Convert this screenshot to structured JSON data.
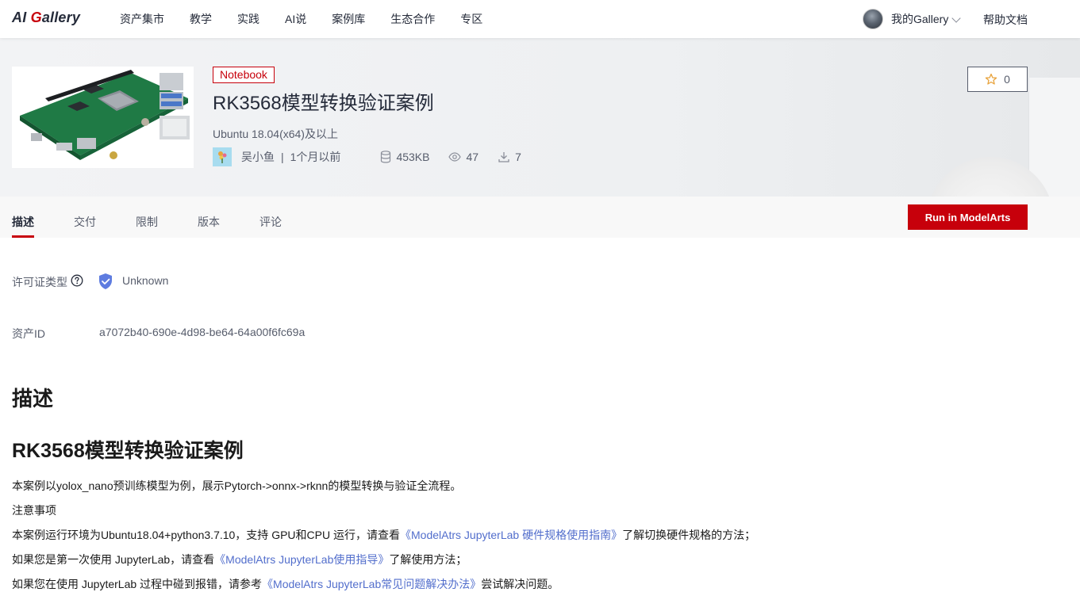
{
  "nav": {
    "logo_prefix": "AI ",
    "logo_accent": "G",
    "logo_suffix": "allery",
    "items": [
      "资产集市",
      "教学",
      "实践",
      "AI说",
      "案例库",
      "生态合作",
      "专区"
    ],
    "user_label": "我的Gallery",
    "help_label": "帮助文档"
  },
  "asset": {
    "badge": "Notebook",
    "title": "RK3568模型转换验证案例",
    "env": "Ubuntu 18.04(x64)及以上",
    "author": "吴小鱼",
    "separator": "|",
    "time": "1个月以前",
    "size": "453KB",
    "views": "47",
    "downloads": "7",
    "stars": "0"
  },
  "tabs": [
    "描述",
    "交付",
    "限制",
    "版本",
    "评论"
  ],
  "run_button": "Run in ModelArts",
  "info": {
    "license_label": "许可证类型",
    "license_value": "Unknown",
    "asset_id_label": "资产ID",
    "asset_id_value": "a7072b40-690e-4d98-be64-64a00f6fc69a"
  },
  "content": {
    "h1": "描述",
    "h2": "RK3568模型转换验证案例",
    "p1": "本案例以yolox_nano预训练模型为例，展示Pytorch->onnx->rknn的模型转换与验证全流程。",
    "p2": "注意事项",
    "p3_pre": "本案例运行环境为Ubuntu18.04+python3.7.10，支持 GPU和CPU 运行，请查看",
    "p3_link": "《ModelAtrs JupyterLab 硬件规格使用指南》",
    "p3_post": "了解切换硬件规格的方法；",
    "p4_pre": "如果您是第一次使用 JupyterLab，请查看",
    "p4_link": "《ModelAtrs JupyterLab使用指导》",
    "p4_post": "了解使用方法；",
    "p5_pre": "如果您在使用 JupyterLab 过程中碰到报错，请参考",
    "p5_link": "《ModelAtrs JupyterLab常见问题解决办法》",
    "p5_post": "尝试解决问题。"
  },
  "colors": {
    "accent": "#c7000b",
    "link": "#526ecc",
    "text": "#252b3a",
    "muted": "#575d6c",
    "shield": "#5e7ce0"
  },
  "icons": [
    "search-icon",
    "chevron-down-icon",
    "star-icon",
    "database-icon",
    "eye-icon",
    "download-icon",
    "help-circle-icon",
    "shield-check-icon"
  ]
}
